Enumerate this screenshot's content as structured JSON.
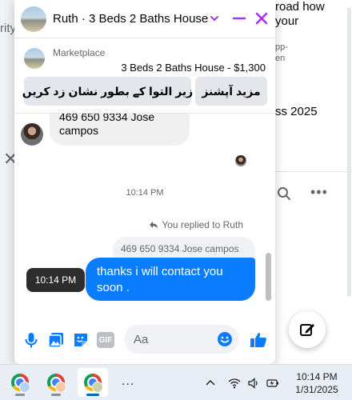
{
  "background": {
    "left_text": "rity",
    "right_snippet_1a": "road how",
    "right_snippet_1b": "your",
    "right_snippet_2a": "pp-",
    "right_snippet_2b": "en",
    "right_snippet_3": "ss 2025"
  },
  "chat": {
    "title": "Ruth · 3 Beds 2 Baths House",
    "listing": {
      "kicker": "Marketplace",
      "title": "3 Beds 2 Baths House - $1,300",
      "more_options_label": "مزید آپشنز",
      "mark_as_label": "زیر التوا کے بطور نشان زد کریں"
    },
    "messages": {
      "incoming_line1": "469 650 9334 Jose",
      "incoming_line2": "campos",
      "timestamp": "10:14 PM",
      "replied_label": "You replied to Ruth",
      "quoted_text": "469 650 9334 Jose campos",
      "outgoing_text": "thanks i will contact you soon .",
      "hover_time": "10:14 PM"
    },
    "composer": {
      "placeholder": "Aa",
      "gif_label": "GIF"
    }
  },
  "taskbar": {
    "time": "10:14 PM",
    "date": "1/31/2025",
    "more": "..."
  },
  "colors": {
    "accent": "#0a7cff",
    "brand_purple": "#a033ff"
  }
}
